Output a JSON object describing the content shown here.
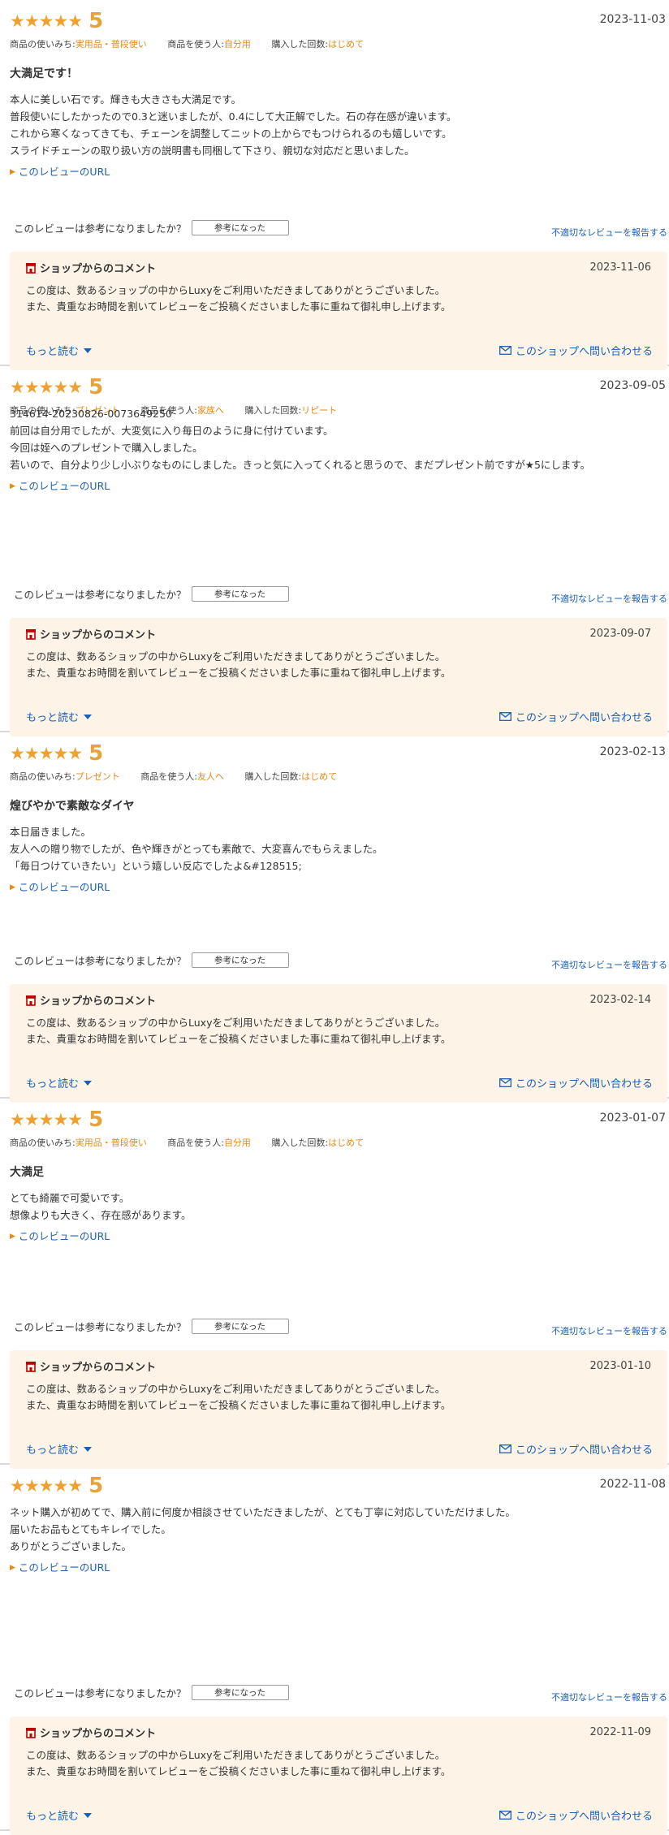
{
  "meta_labels": {
    "usage": "商品の使いみち:",
    "user": "商品を使う人:",
    "count": "購入した回数:"
  },
  "reviews": [
    {
      "stars": "★★★★★",
      "score": "5",
      "date": "2023-11-03",
      "usage": "実用品・普段使い",
      "user": "自分用",
      "count": "はじめて",
      "title": "大満足です！",
      "body": "本人に美しい石です。輝きも大きさも大満足です。\n普段使いにしたかったので0.3と迷いましたが、0.4にして大正解でした。石の存在感が違います。\nこれから寒くなってきても、チェーンを調整してニットの上からでもつけられるのも嬉しいです。\nスライドチェーンの取り扱い方の説明書も同梱して下さり、親切な対応だと思いました。",
      "url_label": "このレビューのURL",
      "helpful_question": "このレビューは参考になりましたか？",
      "helpful_button": "参考になった",
      "report_label": "不適切なレビューを報告する",
      "shop_title": "ショップからのコメント",
      "shop_date": "2023-11-06",
      "shop_text": "この度は、数あるショップの中からLuxyをご利用いただきましてありがとうございました。\nまた、貴重なお時間を割いてレビューをご投稿くださいました事に重ねて御礼申し上げます。",
      "more_label": "もっと読む",
      "contact_label": "このショップへ問い合わせる"
    },
    {
      "stars": "★★★★★",
      "score": "5",
      "date": "2023-09-05",
      "usage": "プレゼント",
      "user": "家族へ",
      "count": "リピート",
      "title": "",
      "body": "314614-20230826-0073649250\n前回は自分用でしたが、大変気に入り毎日のように身に付けています。\n今回は姪へのプレゼントで購入しました。\n若いので、自分より少し小ぶりなものにしました。きっと気に入ってくれると思うので、まだプレゼント前ですが★5にします。",
      "url_label": "このレビューのURL",
      "helpful_question": "このレビューは参考になりましたか？",
      "helpful_button": "参考になった",
      "report_label": "不適切なレビューを報告する",
      "shop_title": "ショップからのコメント",
      "shop_date": "2023-09-07",
      "shop_text": "この度は、数あるショップの中からLuxyをご利用いただきましてありがとうございました。\nまた、貴重なお時間を割いてレビューをご投稿くださいました事に重ねて御礼申し上げます。",
      "more_label": "もっと読む",
      "contact_label": "このショップへ問い合わせる"
    },
    {
      "stars": "★★★★★",
      "score": "5",
      "date": "2023-02-13",
      "usage": "プレゼント",
      "user": "友人へ",
      "count": "はじめて",
      "title": "煌びやかで素敵なダイヤ",
      "body": "本日届きました。\n友人への贈り物でしたが、色や輝きがとっても素敵で、大変喜んでもらえました。\n「毎日つけていきたい」という嬉しい反応でしたよ&#128515;",
      "url_label": "このレビューのURL",
      "helpful_question": "このレビューは参考になりましたか？",
      "helpful_button": "参考になった",
      "report_label": "不適切なレビューを報告する",
      "shop_title": "ショップからのコメント",
      "shop_date": "2023-02-14",
      "shop_text": "この度は、数あるショップの中からLuxyをご利用いただきましてありがとうございました。\nまた、貴重なお時間を割いてレビューをご投稿くださいました事に重ねて御礼申し上げます。",
      "more_label": "もっと読む",
      "contact_label": "このショップへ問い合わせる"
    },
    {
      "stars": "★★★★★",
      "score": "5",
      "date": "2023-01-07",
      "usage": "実用品・普段使い",
      "user": "自分用",
      "count": "はじめて",
      "title": "大満足",
      "body": "とても綺麗で可愛いです。\n想像よりも大きく、存在感があります。",
      "url_label": "このレビューのURL",
      "helpful_question": "このレビューは参考になりましたか？",
      "helpful_button": "参考になった",
      "report_label": "不適切なレビューを報告する",
      "shop_title": "ショップからのコメント",
      "shop_date": "2023-01-10",
      "shop_text": "この度は、数あるショップの中からLuxyをご利用いただきましてありがとうございました。\nまた、貴重なお時間を割いてレビューをご投稿くださいました事に重ねて御礼申し上げます。",
      "more_label": "もっと読む",
      "contact_label": "このショップへ問い合わせる"
    },
    {
      "stars": "★★★★★",
      "score": "5",
      "date": "2022-11-08",
      "usage": "",
      "user": "",
      "count": "",
      "title": "",
      "body": "ネット購入が初めてで、購入前に何度か相談させていただきましたが、とても丁寧に対応していただけました。\n届いたお品もとてもキレイでした。\nありがとうございました。",
      "url_label": "このレビューのURL",
      "helpful_question": "このレビューは参考になりましたか？",
      "helpful_button": "参考になった",
      "report_label": "不適切なレビューを報告する",
      "shop_title": "ショップからのコメント",
      "shop_date": "2022-11-09",
      "shop_text": "この度は、数あるショップの中からLuxyをご利用いただきましてありがとうございました。\nまた、貴重なお時間を割いてレビューをご投稿くださいました事に重ねて御礼申し上げます。",
      "more_label": "もっと読む",
      "contact_label": "このショップへ問い合わせる"
    }
  ]
}
